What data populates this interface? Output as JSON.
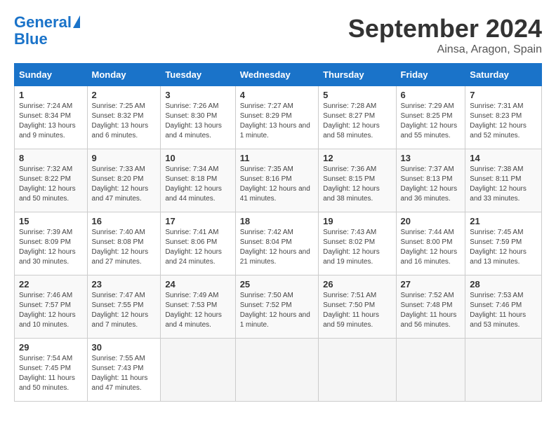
{
  "header": {
    "logo_line1": "General",
    "logo_line2": "Blue",
    "month_title": "September 2024",
    "location": "Ainsa, Aragon, Spain"
  },
  "days_of_week": [
    "Sunday",
    "Monday",
    "Tuesday",
    "Wednesday",
    "Thursday",
    "Friday",
    "Saturday"
  ],
  "weeks": [
    [
      {
        "day": "1",
        "sunrise": "7:24 AM",
        "sunset": "8:34 PM",
        "daylight": "13 hours and 9 minutes."
      },
      {
        "day": "2",
        "sunrise": "7:25 AM",
        "sunset": "8:32 PM",
        "daylight": "13 hours and 6 minutes."
      },
      {
        "day": "3",
        "sunrise": "7:26 AM",
        "sunset": "8:30 PM",
        "daylight": "13 hours and 4 minutes."
      },
      {
        "day": "4",
        "sunrise": "7:27 AM",
        "sunset": "8:29 PM",
        "daylight": "13 hours and 1 minute."
      },
      {
        "day": "5",
        "sunrise": "7:28 AM",
        "sunset": "8:27 PM",
        "daylight": "12 hours and 58 minutes."
      },
      {
        "day": "6",
        "sunrise": "7:29 AM",
        "sunset": "8:25 PM",
        "daylight": "12 hours and 55 minutes."
      },
      {
        "day": "7",
        "sunrise": "7:31 AM",
        "sunset": "8:23 PM",
        "daylight": "12 hours and 52 minutes."
      }
    ],
    [
      {
        "day": "8",
        "sunrise": "7:32 AM",
        "sunset": "8:22 PM",
        "daylight": "12 hours and 50 minutes."
      },
      {
        "day": "9",
        "sunrise": "7:33 AM",
        "sunset": "8:20 PM",
        "daylight": "12 hours and 47 minutes."
      },
      {
        "day": "10",
        "sunrise": "7:34 AM",
        "sunset": "8:18 PM",
        "daylight": "12 hours and 44 minutes."
      },
      {
        "day": "11",
        "sunrise": "7:35 AM",
        "sunset": "8:16 PM",
        "daylight": "12 hours and 41 minutes."
      },
      {
        "day": "12",
        "sunrise": "7:36 AM",
        "sunset": "8:15 PM",
        "daylight": "12 hours and 38 minutes."
      },
      {
        "day": "13",
        "sunrise": "7:37 AM",
        "sunset": "8:13 PM",
        "daylight": "12 hours and 36 minutes."
      },
      {
        "day": "14",
        "sunrise": "7:38 AM",
        "sunset": "8:11 PM",
        "daylight": "12 hours and 33 minutes."
      }
    ],
    [
      {
        "day": "15",
        "sunrise": "7:39 AM",
        "sunset": "8:09 PM",
        "daylight": "12 hours and 30 minutes."
      },
      {
        "day": "16",
        "sunrise": "7:40 AM",
        "sunset": "8:08 PM",
        "daylight": "12 hours and 27 minutes."
      },
      {
        "day": "17",
        "sunrise": "7:41 AM",
        "sunset": "8:06 PM",
        "daylight": "12 hours and 24 minutes."
      },
      {
        "day": "18",
        "sunrise": "7:42 AM",
        "sunset": "8:04 PM",
        "daylight": "12 hours and 21 minutes."
      },
      {
        "day": "19",
        "sunrise": "7:43 AM",
        "sunset": "8:02 PM",
        "daylight": "12 hours and 19 minutes."
      },
      {
        "day": "20",
        "sunrise": "7:44 AM",
        "sunset": "8:00 PM",
        "daylight": "12 hours and 16 minutes."
      },
      {
        "day": "21",
        "sunrise": "7:45 AM",
        "sunset": "7:59 PM",
        "daylight": "12 hours and 13 minutes."
      }
    ],
    [
      {
        "day": "22",
        "sunrise": "7:46 AM",
        "sunset": "7:57 PM",
        "daylight": "12 hours and 10 minutes."
      },
      {
        "day": "23",
        "sunrise": "7:47 AM",
        "sunset": "7:55 PM",
        "daylight": "12 hours and 7 minutes."
      },
      {
        "day": "24",
        "sunrise": "7:49 AM",
        "sunset": "7:53 PM",
        "daylight": "12 hours and 4 minutes."
      },
      {
        "day": "25",
        "sunrise": "7:50 AM",
        "sunset": "7:52 PM",
        "daylight": "12 hours and 1 minute."
      },
      {
        "day": "26",
        "sunrise": "7:51 AM",
        "sunset": "7:50 PM",
        "daylight": "11 hours and 59 minutes."
      },
      {
        "day": "27",
        "sunrise": "7:52 AM",
        "sunset": "7:48 PM",
        "daylight": "11 hours and 56 minutes."
      },
      {
        "day": "28",
        "sunrise": "7:53 AM",
        "sunset": "7:46 PM",
        "daylight": "11 hours and 53 minutes."
      }
    ],
    [
      {
        "day": "29",
        "sunrise": "7:54 AM",
        "sunset": "7:45 PM",
        "daylight": "11 hours and 50 minutes."
      },
      {
        "day": "30",
        "sunrise": "7:55 AM",
        "sunset": "7:43 PM",
        "daylight": "11 hours and 47 minutes."
      },
      null,
      null,
      null,
      null,
      null
    ]
  ]
}
